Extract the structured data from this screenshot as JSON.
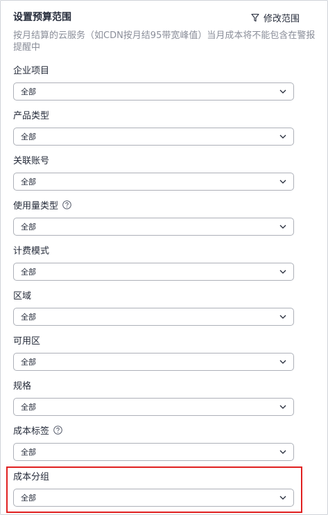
{
  "header": {
    "title": "设置预算范围",
    "edit_scope_label": "修改范围",
    "edit_scope_icon": "filter-icon"
  },
  "description": "按月结算的云服务（如CDN按月结95带宽峰值）当月成本将不能包含在警报提醒中",
  "fields": [
    {
      "label": "企业项目",
      "value": "全部",
      "help": false
    },
    {
      "label": "产品类型",
      "value": "全部",
      "help": false
    },
    {
      "label": "关联账号",
      "value": "全部",
      "help": false
    },
    {
      "label": "使用量类型",
      "value": "全部",
      "help": true
    },
    {
      "label": "计费模式",
      "value": "全部",
      "help": false
    },
    {
      "label": "区域",
      "value": "全部",
      "help": false
    },
    {
      "label": "可用区",
      "value": "全部",
      "help": false
    },
    {
      "label": "规格",
      "value": "全部",
      "help": false
    },
    {
      "label": "成本标签",
      "value": "全部",
      "help": true
    },
    {
      "label": "成本分组",
      "value": "全部",
      "help": false
    }
  ],
  "colors": {
    "highlight_border": "#e02020",
    "select_border": "#adb0b8",
    "description_text": "#8a8e99"
  }
}
